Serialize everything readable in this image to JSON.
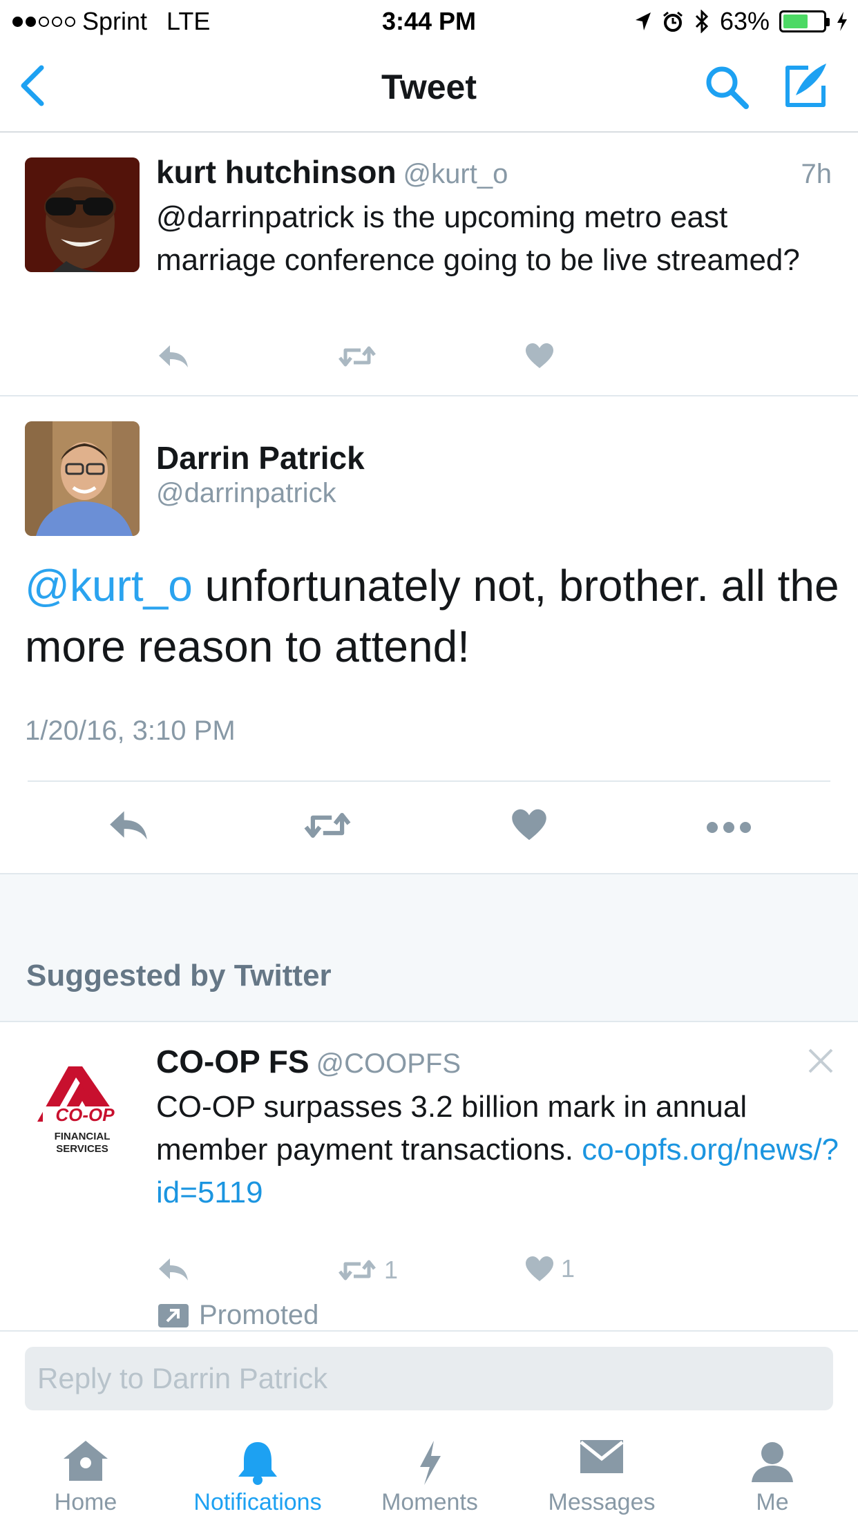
{
  "status_bar": {
    "carrier": "Sprint",
    "network": "LTE",
    "time": "3:44 PM",
    "battery": "63%",
    "battery_level": 0.63
  },
  "nav": {
    "title": "Tweet"
  },
  "reply_tweet": {
    "name": "kurt hutchinson",
    "handle": "@kurt_o",
    "time_ago": "7h",
    "text": "@darrinpatrick is the upcoming metro east marriage conference going to be live streamed?"
  },
  "main_tweet": {
    "name": "Darrin Patrick",
    "handle": "@darrinpatrick",
    "mention": "@kurt_o",
    "text": " unfortunately not, brother. all the more reason to attend!",
    "timestamp": "1/20/16, 3:10 PM"
  },
  "suggested": {
    "title": "Suggested by Twitter"
  },
  "promoted_tweet": {
    "name": "CO-OP FS",
    "handle": "@COOPFS",
    "text": "CO-OP surpasses 3.2 billion mark in annual member payment transactions. ",
    "link": "co-opfs.org/news/?id=5119",
    "retweet_count": "1",
    "like_count": "1",
    "promoted_label": "Promoted",
    "logo_text": "CO-OP",
    "logo_subtext_1": "FINANCIAL",
    "logo_subtext_2": "SERVICES"
  },
  "reply": {
    "placeholder": "Reply to Darrin Patrick"
  },
  "tabs": [
    {
      "label": "Home",
      "icon": "home-icon"
    },
    {
      "label": "Notifications",
      "icon": "bell-icon"
    },
    {
      "label": "Moments",
      "icon": "lightning-icon"
    },
    {
      "label": "Messages",
      "icon": "envelope-icon"
    },
    {
      "label": "Me",
      "icon": "person-icon"
    }
  ],
  "colors": {
    "accent": "#1da1f2",
    "muted": "#8899a6",
    "battery_green": "#4cd964",
    "logo_red": "#c8102e"
  }
}
